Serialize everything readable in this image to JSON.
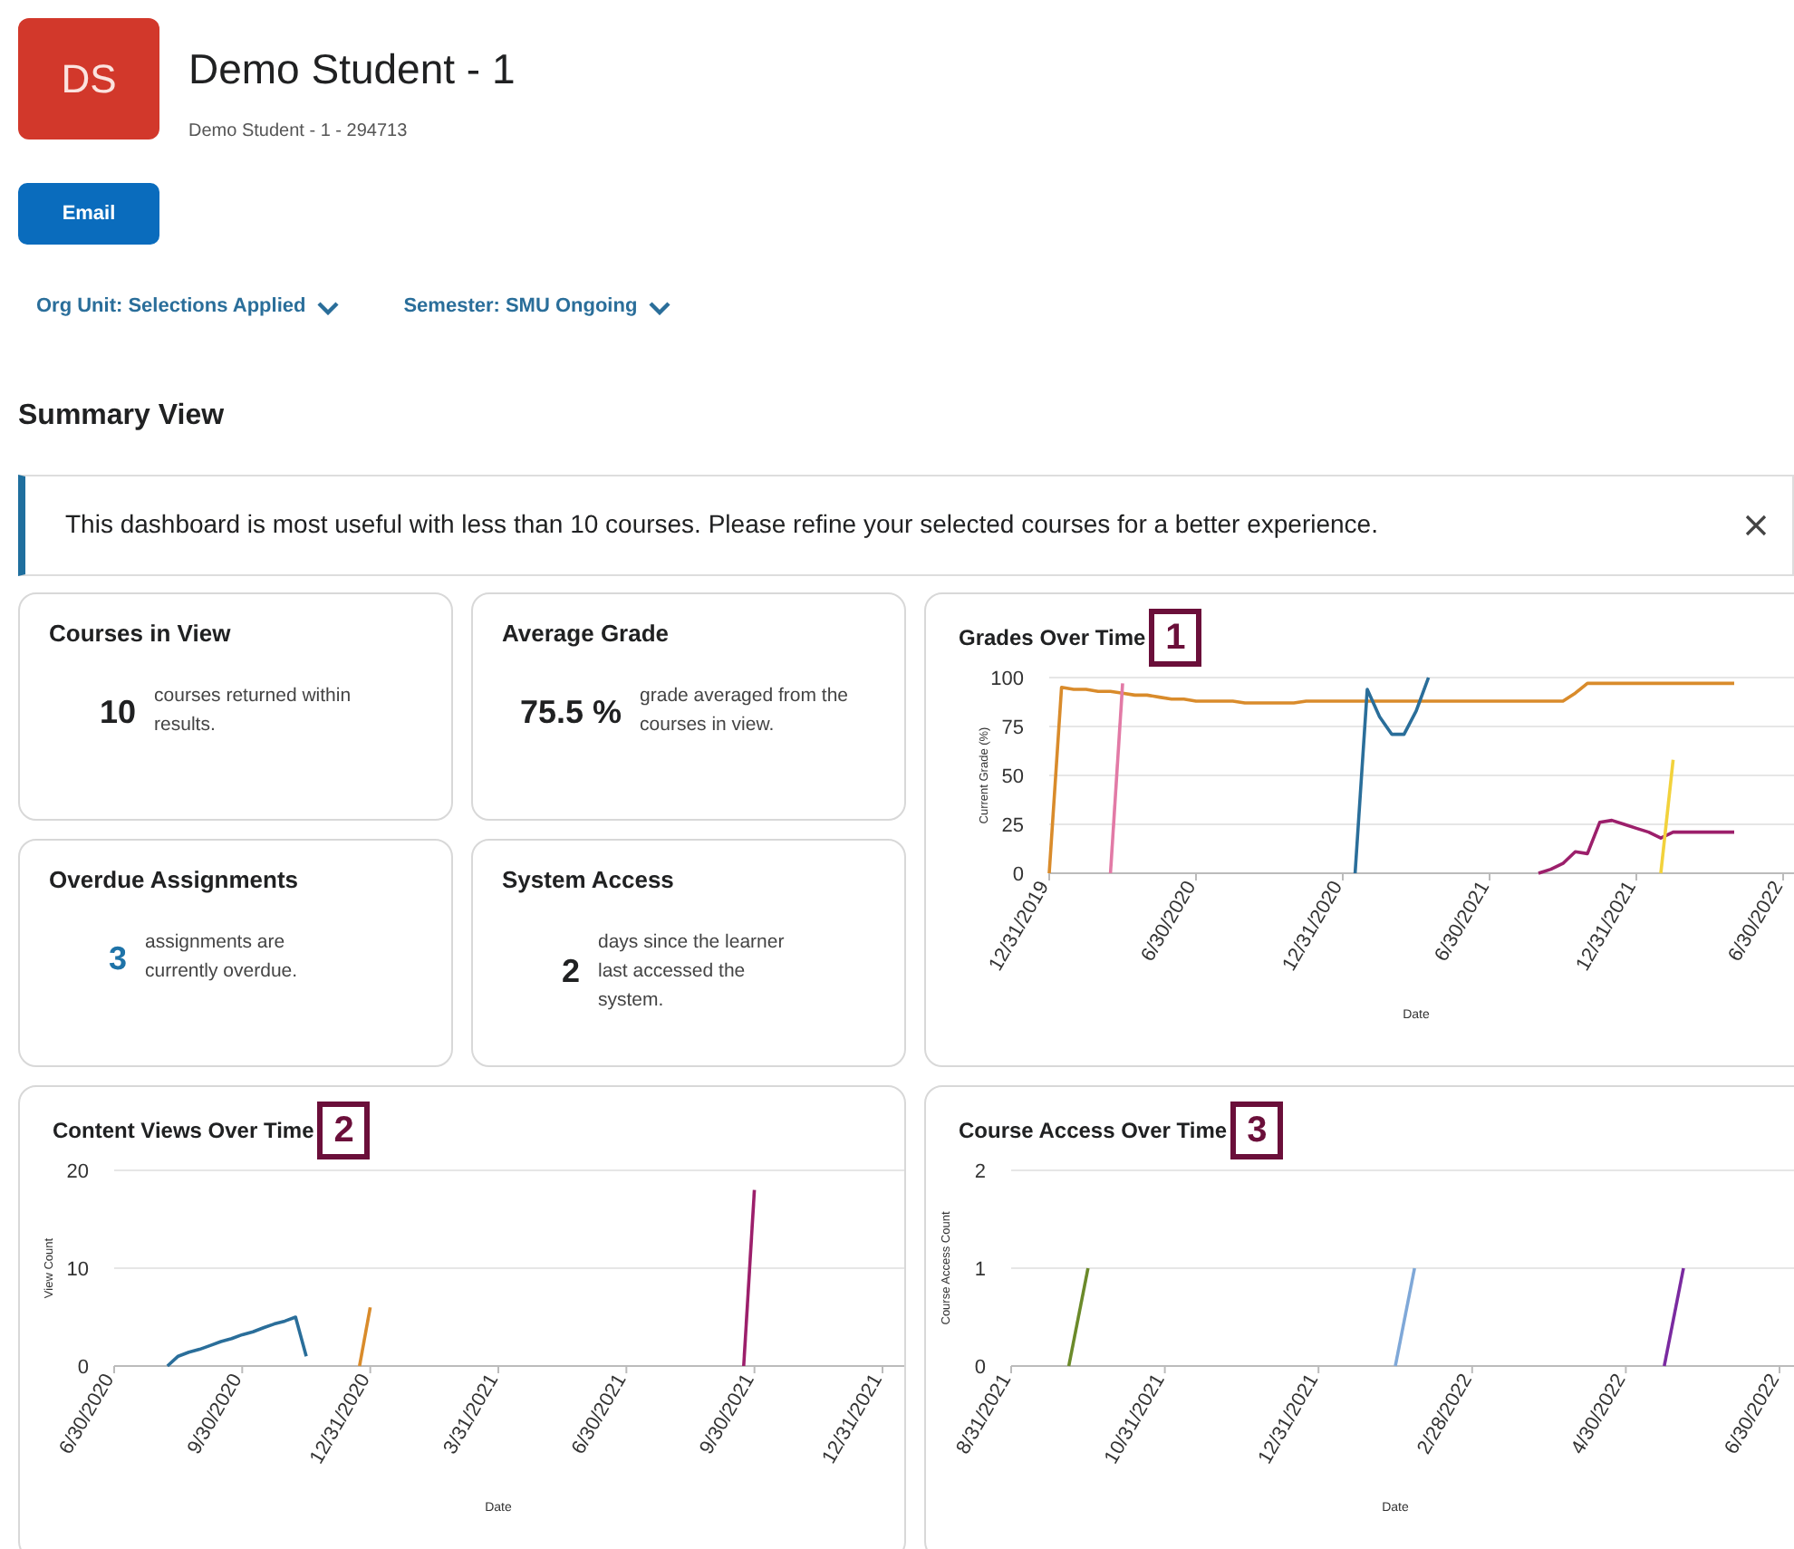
{
  "header": {
    "avatar_initials": "DS",
    "name": "Demo Student - 1",
    "subtitle": "Demo Student - 1 - 294713"
  },
  "email_button": "Email",
  "filters": [
    {
      "label": "Org Unit: Selections Applied"
    },
    {
      "label": "Semester: SMU Ongoing"
    }
  ],
  "section_title": "Summary View",
  "alert": {
    "message": "This dashboard is most useful with less than 10 courses. Please refine your selected courses for a better experience."
  },
  "stats": [
    {
      "title": "Courses in View",
      "value": "10",
      "description": "courses returned within results.",
      "kind": "plain"
    },
    {
      "title": "Average Grade",
      "value": "75.5 %",
      "description": "grade averaged from the courses in view.",
      "kind": "plain"
    },
    {
      "title": "Overdue Assignments",
      "value": "3",
      "description": "assignments are currently overdue.",
      "kind": "link"
    },
    {
      "title": "System Access",
      "value": "2",
      "description": "days since the learner last accessed the system.",
      "kind": "plain"
    }
  ],
  "charts": [
    {
      "callout": "1",
      "chart_data": {
        "type": "line",
        "title": "Grades Over Time",
        "xlabel": "Date",
        "ylabel": "Current Grade (%)",
        "ylim": [
          0,
          100
        ],
        "categories": [
          "12/31/2019",
          null,
          null,
          null,
          null,
          null,
          null,
          null,
          null,
          null,
          null,
          null,
          "6/30/2020",
          null,
          null,
          null,
          null,
          null,
          null,
          null,
          null,
          null,
          null,
          null,
          "12/31/2020",
          null,
          null,
          null,
          null,
          null,
          null,
          null,
          null,
          null,
          null,
          null,
          "6/30/2021",
          null,
          null,
          null,
          null,
          null,
          null,
          null,
          null,
          null,
          null,
          null,
          "12/31/2021",
          null,
          null,
          null,
          null,
          null,
          null,
          null,
          null,
          null,
          null,
          null,
          "6/30/2022"
        ],
        "yticks": [
          0,
          25,
          50,
          75,
          100
        ],
        "grid": true,
        "series": [
          {
            "color": "#d98b2b",
            "values": [
              0,
              95,
              94,
              94,
              93,
              93,
              92,
              91,
              91,
              90,
              89,
              89,
              88,
              88,
              88,
              88,
              87,
              87,
              87,
              87,
              87,
              88,
              88,
              88,
              88,
              88,
              88,
              88,
              88,
              88,
              88,
              88,
              88,
              88,
              88,
              88,
              88,
              88,
              88,
              88,
              88,
              88,
              88,
              92,
              97,
              97,
              97,
              97,
              97,
              97,
              97,
              97,
              97,
              97,
              97,
              97,
              97,
              null,
              null,
              null,
              null
            ]
          },
          {
            "color": "#e27aa6",
            "values": [
              null,
              null,
              null,
              null,
              null,
              0,
              97,
              null,
              null,
              null,
              null,
              null,
              null,
              null,
              null,
              null,
              null,
              null,
              null,
              null,
              null,
              null,
              null,
              null,
              null,
              null,
              null,
              null,
              null,
              null,
              null,
              null,
              null,
              null,
              null,
              null,
              null,
              null,
              null,
              null,
              null,
              null,
              null,
              null,
              null,
              null,
              null,
              null,
              null,
              null,
              null,
              null,
              null,
              null,
              null,
              null,
              null,
              null,
              null,
              null,
              null
            ]
          },
          {
            "color": "#2a6e9a",
            "values": [
              null,
              null,
              null,
              null,
              null,
              null,
              null,
              null,
              null,
              null,
              null,
              null,
              null,
              null,
              null,
              null,
              null,
              null,
              null,
              null,
              null,
              null,
              null,
              null,
              null,
              0,
              94,
              80,
              71,
              71,
              83,
              100,
              null,
              null,
              null,
              null,
              null,
              null,
              null,
              null,
              null,
              null,
              null,
              null,
              null,
              null,
              null,
              null,
              null,
              null,
              null,
              null,
              null,
              null,
              null,
              null,
              null,
              null,
              null,
              null,
              null
            ]
          },
          {
            "color": "#9c1f6b",
            "values": [
              null,
              null,
              null,
              null,
              null,
              null,
              null,
              null,
              null,
              null,
              null,
              null,
              null,
              null,
              null,
              null,
              null,
              null,
              null,
              null,
              null,
              null,
              null,
              null,
              null,
              null,
              null,
              null,
              null,
              null,
              null,
              null,
              null,
              null,
              null,
              null,
              null,
              null,
              null,
              null,
              0,
              2,
              5,
              11,
              10,
              26,
              27,
              25,
              23,
              21,
              18,
              21,
              21,
              21,
              21,
              21,
              21,
              null,
              null,
              null,
              null
            ]
          },
          {
            "color": "#f2d23c",
            "values": [
              null,
              null,
              null,
              null,
              null,
              null,
              null,
              null,
              null,
              null,
              null,
              null,
              null,
              null,
              null,
              null,
              null,
              null,
              null,
              null,
              null,
              null,
              null,
              null,
              null,
              null,
              null,
              null,
              null,
              null,
              null,
              null,
              null,
              null,
              null,
              null,
              null,
              null,
              null,
              null,
              null,
              null,
              null,
              null,
              null,
              null,
              null,
              null,
              null,
              null,
              0,
              58,
              null,
              null,
              null,
              null,
              null,
              null,
              null,
              null,
              null
            ]
          }
        ]
      }
    },
    {
      "callout": "2",
      "chart_data": {
        "type": "line",
        "title": "Content Views Over Time",
        "xlabel": "Date",
        "ylabel": "View Count",
        "ylim": [
          0,
          20
        ],
        "categories": [
          "6/30/2020",
          null,
          null,
          null,
          null,
          null,
          null,
          null,
          null,
          null,
          null,
          null,
          "9/30/2020",
          null,
          null,
          null,
          null,
          null,
          null,
          null,
          null,
          null,
          null,
          null,
          "12/31/2020",
          null,
          null,
          null,
          null,
          null,
          null,
          null,
          null,
          null,
          null,
          null,
          "3/31/2021",
          null,
          null,
          null,
          null,
          null,
          null,
          null,
          null,
          null,
          null,
          null,
          "6/30/2021",
          null,
          null,
          null,
          null,
          null,
          null,
          null,
          null,
          null,
          null,
          null,
          "9/30/2021",
          null,
          null,
          null,
          null,
          null,
          null,
          null,
          null,
          null,
          null,
          null,
          "12/31/2021"
        ],
        "yticks": [
          0,
          10,
          20
        ],
        "grid": true,
        "series": [
          {
            "color": "#2a6e9a",
            "values": [
              null,
              null,
              null,
              null,
              null,
              0,
              1,
              1.4,
              1.7,
              2.1,
              2.5,
              2.8,
              3.2,
              3.5,
              3.9,
              4.3,
              4.6,
              5,
              1,
              null,
              null,
              null,
              null,
              null,
              null,
              null,
              null,
              null,
              null,
              null,
              null,
              null,
              null,
              null,
              null,
              null,
              null,
              null,
              null,
              null,
              null,
              null,
              null,
              null,
              null,
              null,
              null,
              null,
              null,
              null,
              null,
              null,
              null,
              null,
              null,
              null,
              null,
              null,
              null,
              null,
              null,
              null,
              null,
              null,
              null,
              null,
              null,
              null,
              null,
              null,
              null,
              null,
              null
            ]
          },
          {
            "color": "#d98b2b",
            "values": [
              null,
              null,
              null,
              null,
              null,
              null,
              null,
              null,
              null,
              null,
              null,
              null,
              null,
              null,
              null,
              null,
              null,
              null,
              null,
              null,
              null,
              null,
              null,
              0,
              6,
              null,
              null,
              null,
              null,
              null,
              null,
              null,
              null,
              null,
              null,
              null,
              null,
              null,
              null,
              null,
              null,
              null,
              null,
              null,
              null,
              null,
              null,
              null,
              null,
              null,
              null,
              null,
              null,
              null,
              null,
              null,
              null,
              null,
              null,
              null,
              null,
              null,
              null,
              null,
              null,
              null,
              null,
              null,
              null,
              null,
              null,
              null,
              null
            ]
          },
          {
            "color": "#9c1f6b",
            "values": [
              null,
              null,
              null,
              null,
              null,
              null,
              null,
              null,
              null,
              null,
              null,
              null,
              null,
              null,
              null,
              null,
              null,
              null,
              null,
              null,
              null,
              null,
              null,
              null,
              null,
              null,
              null,
              null,
              null,
              null,
              null,
              null,
              null,
              null,
              null,
              null,
              null,
              null,
              null,
              null,
              null,
              null,
              null,
              null,
              null,
              null,
              null,
              null,
              null,
              null,
              null,
              null,
              null,
              null,
              null,
              null,
              null,
              null,
              null,
              0,
              18,
              null,
              null,
              null,
              null,
              null,
              null,
              null,
              null,
              null,
              null,
              null,
              null
            ]
          }
        ]
      }
    },
    {
      "callout": "3",
      "chart_data": {
        "type": "line",
        "title": "Course Access Over Time",
        "xlabel": "Date",
        "ylabel": "Course Access Count",
        "ylim": [
          0,
          2
        ],
        "categories": [
          "8/31/2021",
          null,
          null,
          null,
          null,
          null,
          null,
          null,
          "10/31/2021",
          null,
          null,
          null,
          null,
          null,
          null,
          null,
          "12/31/2021",
          null,
          null,
          null,
          null,
          null,
          null,
          null,
          "2/28/2022",
          null,
          null,
          null,
          null,
          null,
          null,
          null,
          "4/30/2022",
          null,
          null,
          null,
          null,
          null,
          null,
          null,
          "6/30/2022"
        ],
        "yticks": [
          0,
          1,
          2
        ],
        "grid": true,
        "series": [
          {
            "color": "#6b8a2a",
            "values": [
              null,
              null,
              null,
              0,
              1,
              null,
              null,
              null,
              null,
              null,
              null,
              null,
              null,
              null,
              null,
              null,
              null,
              null,
              null,
              null,
              null,
              null,
              null,
              null,
              null,
              null,
              null,
              null,
              null,
              null,
              null,
              null,
              null,
              null,
              null,
              null,
              null,
              null,
              null,
              null,
              null
            ]
          },
          {
            "color": "#7fa8d8",
            "values": [
              null,
              null,
              null,
              null,
              null,
              null,
              null,
              null,
              null,
              null,
              null,
              null,
              null,
              null,
              null,
              null,
              null,
              null,
              null,
              null,
              0,
              1,
              null,
              null,
              null,
              null,
              null,
              null,
              null,
              null,
              null,
              null,
              null,
              null,
              null,
              null,
              null,
              null,
              null,
              null,
              null
            ]
          },
          {
            "color": "#7a2aa0",
            "values": [
              null,
              null,
              null,
              null,
              null,
              null,
              null,
              null,
              null,
              null,
              null,
              null,
              null,
              null,
              null,
              null,
              null,
              null,
              null,
              null,
              null,
              null,
              null,
              null,
              null,
              null,
              null,
              null,
              null,
              null,
              null,
              null,
              null,
              null,
              0,
              1,
              null,
              null,
              null,
              null,
              null
            ]
          }
        ]
      }
    }
  ]
}
